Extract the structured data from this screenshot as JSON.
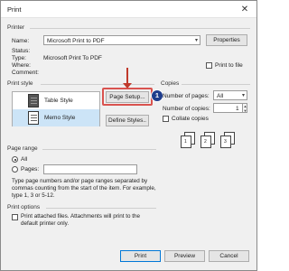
{
  "window": {
    "title": "Print",
    "close_glyph": "✕"
  },
  "printer": {
    "group_label": "Printer",
    "name_label": "Name:",
    "name_value": "Microsoft Print to PDF",
    "properties_label": "Properties",
    "status_label": "Status:",
    "type_label": "Type:",
    "type_value": "Microsoft Print To PDF",
    "where_label": "Where:",
    "comment_label": "Comment:",
    "print_to_file_label": "Print to file"
  },
  "print_style": {
    "group_label": "Print style",
    "styles": [
      {
        "label": "Table Style",
        "selected": false
      },
      {
        "label": "Memo Style",
        "selected": true
      }
    ],
    "page_setup_label": "Page Setup...",
    "define_styles_label": "Define Styles..",
    "callout_number": "1"
  },
  "copies": {
    "group_label": "Copies",
    "number_of_pages_label": "Number of pages:",
    "number_of_pages_value": "All",
    "number_of_copies_label": "Number of copies:",
    "number_of_copies_value": "1",
    "collate_label": "Collate copies",
    "collate_pages": [
      "1",
      "1",
      "2",
      "2",
      "3",
      "3"
    ]
  },
  "page_range": {
    "group_label": "Page range",
    "all_label": "All",
    "pages_label": "Pages:",
    "pages_value": "",
    "help_text": "Type page numbers and/or page ranges separated by commas counting from the start of the item.  For example, type 1, 3 or 5-12."
  },
  "print_options": {
    "group_label": "Print options",
    "attached_label": "Print attached files.  Attachments will print to the default printer only."
  },
  "footer": {
    "print_label": "Print",
    "preview_label": "Preview",
    "cancel_label": "Cancel"
  },
  "colors": {
    "accent": "#0078d7",
    "highlight": "#d9534f",
    "callout": "#1f3c8c",
    "selection": "#cce4f7"
  }
}
